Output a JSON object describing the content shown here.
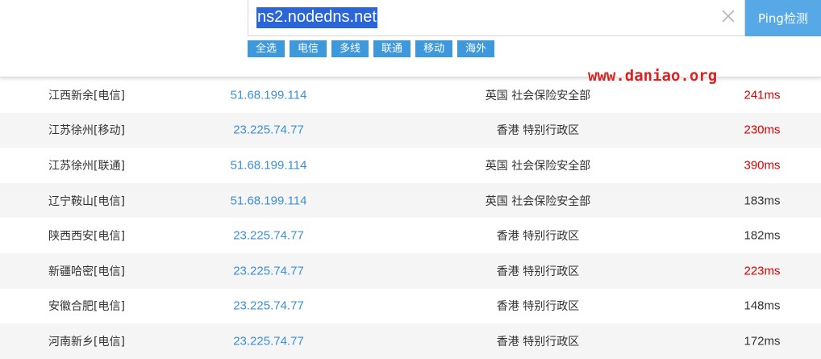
{
  "search": {
    "value": "ns2.nodedns.net",
    "button_label": "Ping检测"
  },
  "filters": [
    "全选",
    "电信",
    "多线",
    "联通",
    "移动",
    "海外"
  ],
  "watermark": "www.daniao.org",
  "results": [
    {
      "location": "江西新余[电信]",
      "ip": "51.68.199.114",
      "geo": "英国 社会保险安全部",
      "latency": "241ms",
      "slow": true
    },
    {
      "location": "江苏徐州[移动]",
      "ip": "23.225.74.77",
      "geo": "香港 特别行政区",
      "latency": "230ms",
      "slow": true
    },
    {
      "location": "江苏徐州[联通]",
      "ip": "51.68.199.114",
      "geo": "英国 社会保险安全部",
      "latency": "390ms",
      "slow": true
    },
    {
      "location": "辽宁鞍山[电信]",
      "ip": "51.68.199.114",
      "geo": "英国 社会保险安全部",
      "latency": "183ms",
      "slow": false
    },
    {
      "location": "陕西西安[电信]",
      "ip": "23.225.74.77",
      "geo": "香港 特别行政区",
      "latency": "182ms",
      "slow": false
    },
    {
      "location": "新疆哈密[电信]",
      "ip": "23.225.74.77",
      "geo": "香港 特别行政区",
      "latency": "223ms",
      "slow": true
    },
    {
      "location": "安徽合肥[电信]",
      "ip": "23.225.74.77",
      "geo": "香港 特别行政区",
      "latency": "148ms",
      "slow": false
    },
    {
      "location": "河南新乡[电信]",
      "ip": "23.225.74.77",
      "geo": "香港 特别行政区",
      "latency": "172ms",
      "slow": false
    }
  ],
  "colors": {
    "accent": "#56a8e6",
    "filter_bg": "#3d98dc",
    "ip_text": "#3b8fd9",
    "slow_latency": "#e00000",
    "row_alt": "#f5f5f5"
  }
}
